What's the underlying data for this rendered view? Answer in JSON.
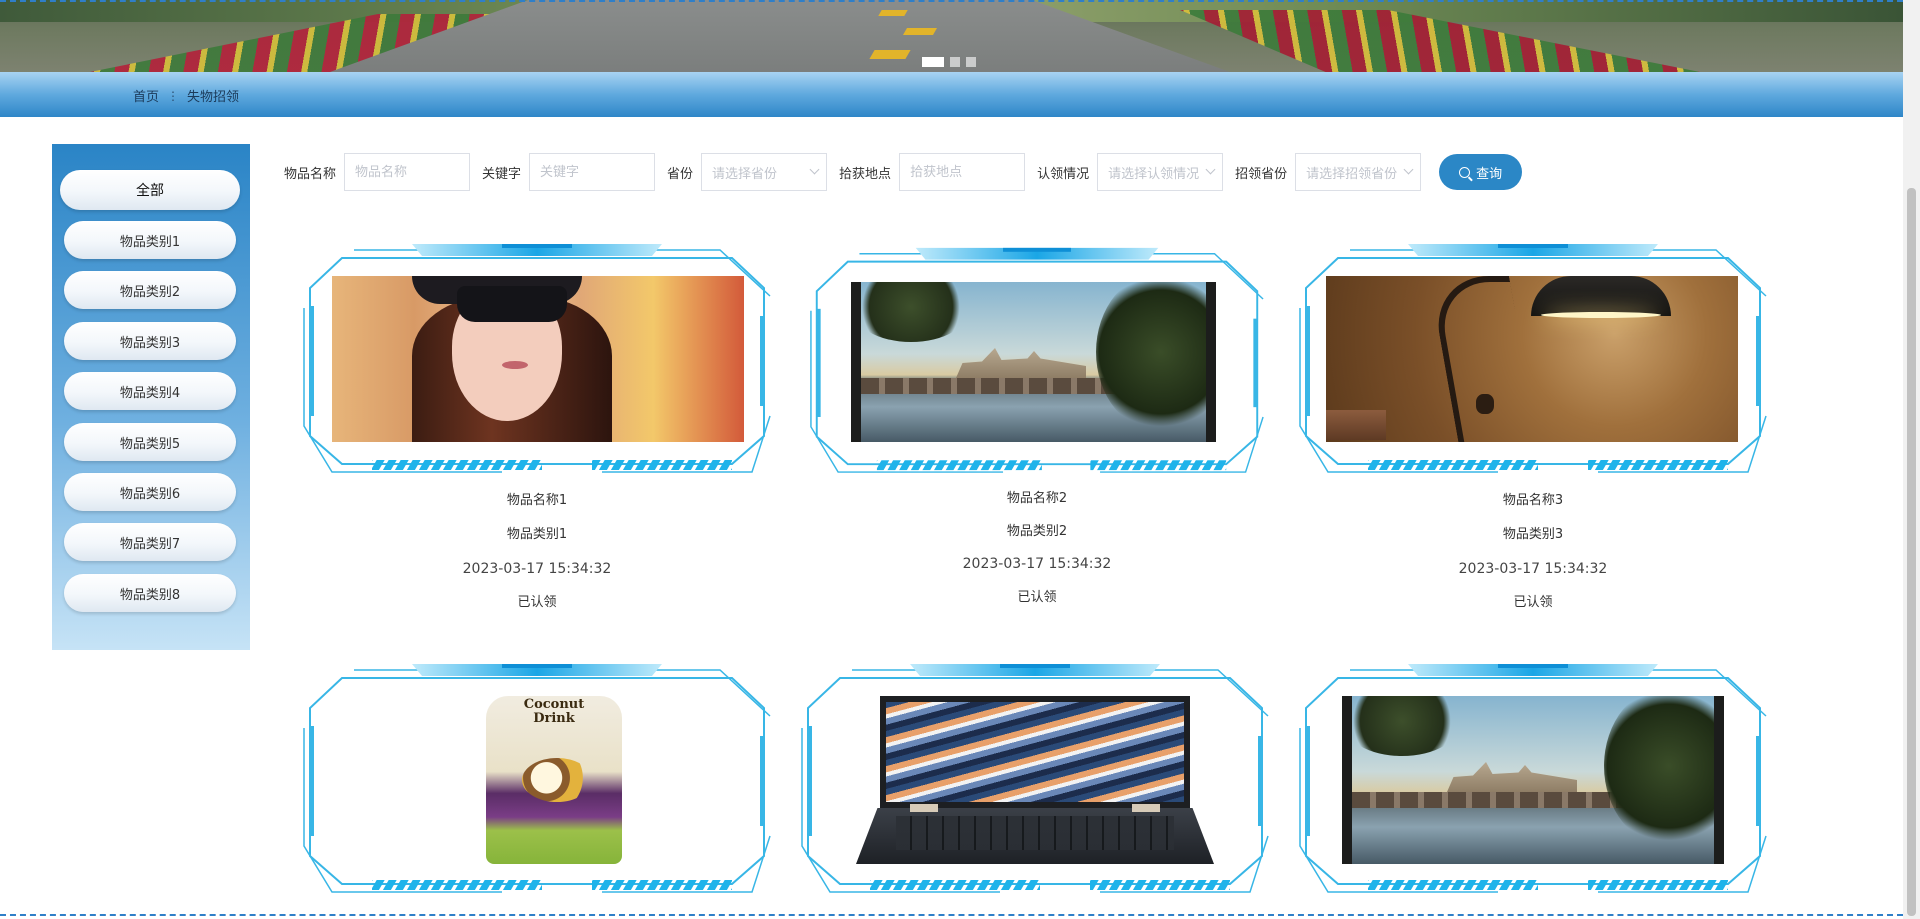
{
  "breadcrumb": {
    "home": "首页",
    "separator": "⋮",
    "current": "失物招领"
  },
  "banner": {
    "slides": 3,
    "active_slide": 1
  },
  "sidebar": {
    "items": [
      "全部",
      "物品类别1",
      "物品类别2",
      "物品类别3",
      "物品类别4",
      "物品类别5",
      "物品类别6",
      "物品类别7",
      "物品类别8"
    ]
  },
  "search": {
    "name_label": "物品名称",
    "name_placeholder": "物品名称",
    "keyword_label": "关键字",
    "keyword_placeholder": "关键字",
    "province_label": "省份",
    "province_placeholder": "请选择省份",
    "location_label": "拾获地点",
    "location_placeholder": "拾获地点",
    "claim_label": "认领情况",
    "claim_placeholder": "请选择认领情况",
    "claim_province_label": "招领省份",
    "claim_province_placeholder": "请选择招领省份",
    "query_button": "查询"
  },
  "colors": {
    "accent": "#2b87c6",
    "frame": "#1fb3ea"
  },
  "items": [
    {
      "name": "物品名称1",
      "category": "物品类别1",
      "time": "2023-03-17 15:34:32",
      "status": "已认领",
      "photo": "woman-sunglasses"
    },
    {
      "name": "物品名称2",
      "category": "物品类别2",
      "time": "2023-03-17 15:34:32",
      "status": "已认领",
      "photo": "city-river"
    },
    {
      "name": "物品名称3",
      "category": "物品类别3",
      "time": "2023-03-17 15:34:32",
      "status": "已认领",
      "photo": "desk-lamp"
    },
    {
      "photo": "coconut-drink",
      "bottle_text": "Coconut Drink"
    },
    {
      "photo": "laptop"
    },
    {
      "photo": "city-river"
    }
  ]
}
